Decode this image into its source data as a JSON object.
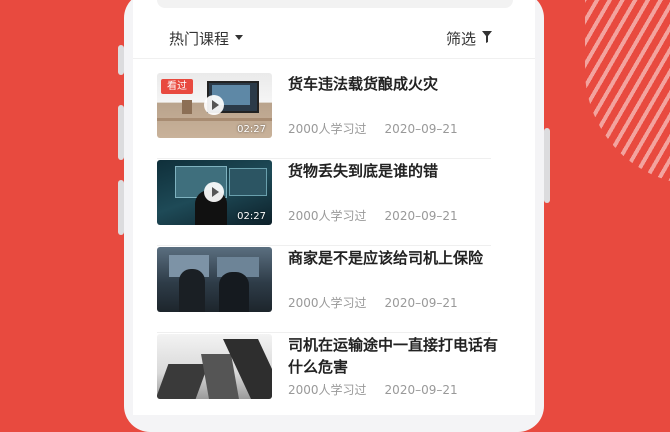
{
  "filters": {
    "sort_label": "热门课程",
    "filter_label": "筛选"
  },
  "courses": [
    {
      "title": "货车违法载货酿成火灾",
      "learners": "2000人学习过",
      "date": "2020–09–21",
      "duration": "02:27",
      "badge": "看过"
    },
    {
      "title": "货物丢失到底是谁的错",
      "learners": "2000人学习过",
      "date": "2020–09–21",
      "duration": "02:27"
    },
    {
      "title": "商家是不是应该给司机上保险",
      "learners": "2000人学习过",
      "date": "2020–09–21"
    },
    {
      "title": "司机在运输途中一直接打电话有什么危害",
      "learners": "2000人学习过",
      "date": "2020–09–21"
    }
  ],
  "colors": {
    "brand": "#e84a3f",
    "meta_text": "#999999"
  },
  "icons": {
    "sort": "caret-down-icon",
    "filter": "funnel-icon",
    "play": "play-icon"
  }
}
